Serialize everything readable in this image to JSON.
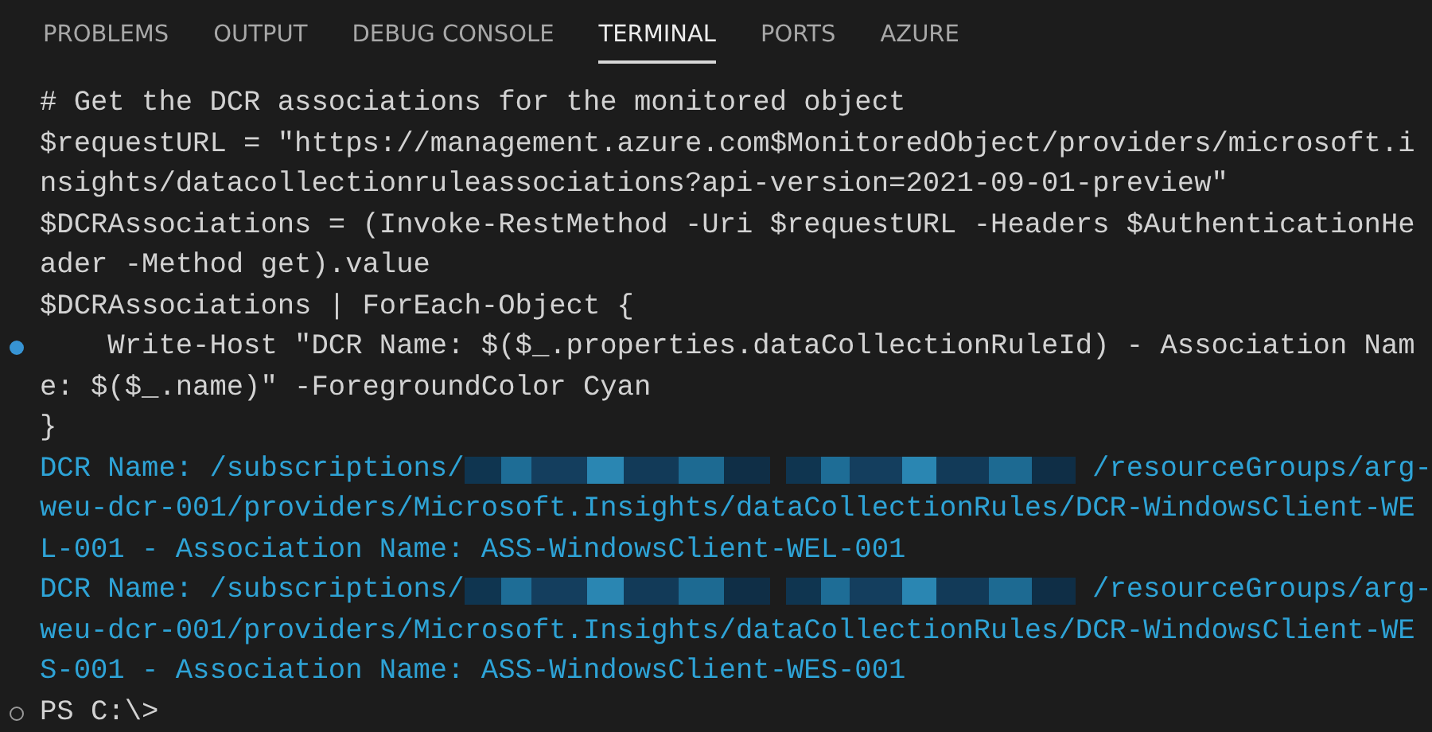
{
  "tabs": [
    {
      "label": "PROBLEMS",
      "selected": false
    },
    {
      "label": "OUTPUT",
      "selected": false
    },
    {
      "label": "DEBUG CONSOLE",
      "selected": false
    },
    {
      "label": "TERMINAL",
      "selected": true
    },
    {
      "label": "PORTS",
      "selected": false
    },
    {
      "label": "AZURE",
      "selected": false
    }
  ],
  "terminal": {
    "lines": [
      {
        "kind": "command",
        "segments": [
          {
            "kind": "text",
            "text": "# Get the DCR associations for the monitored object"
          }
        ]
      },
      {
        "kind": "command",
        "segments": [
          {
            "kind": "text",
            "text": "$requestURL = \"https://management.azure.com$MonitoredObject/providers/microsoft.i"
          }
        ]
      },
      {
        "kind": "command",
        "segments": [
          {
            "kind": "text",
            "text": "nsights/datacollectionruleassociations?api-version=2021-09-01-preview\""
          }
        ]
      },
      {
        "kind": "command",
        "segments": [
          {
            "kind": "text",
            "text": "$DCRAssociations = (Invoke-RestMethod -Uri $requestURL -Headers $AuthenticationHe"
          }
        ]
      },
      {
        "kind": "command",
        "segments": [
          {
            "kind": "text",
            "text": "ader -Method get).value"
          }
        ]
      },
      {
        "kind": "command",
        "segments": [
          {
            "kind": "text",
            "text": "$DCRAssociations | ForEach-Object {"
          }
        ]
      },
      {
        "kind": "command",
        "marker": {
          "kind": "dot"
        },
        "segments": [
          {
            "kind": "text",
            "text": "    Write-Host \"DCR Name: $($_.properties.dataCollectionRuleId) - Association Nam"
          }
        ]
      },
      {
        "kind": "command",
        "segments": [
          {
            "kind": "text",
            "text": "e: $($_.name)\" -ForegroundColor Cyan"
          }
        ]
      },
      {
        "kind": "command",
        "segments": [
          {
            "kind": "text",
            "text": "}"
          }
        ]
      },
      {
        "kind": "output",
        "segments": [
          {
            "kind": "text",
            "text": "DCR Name: /subscriptions/"
          },
          {
            "kind": "redaction"
          },
          {
            "kind": "redaction"
          },
          {
            "kind": "text",
            "text": "/resourceGroups/arg-"
          }
        ]
      },
      {
        "kind": "output",
        "segments": [
          {
            "kind": "text",
            "text": "weu-dcr-001/providers/Microsoft.Insights/dataCollectionRules/DCR-WindowsClient-WE"
          }
        ]
      },
      {
        "kind": "output",
        "segments": [
          {
            "kind": "text",
            "text": "L-001 - Association Name: ASS-WindowsClient-WEL-001"
          }
        ]
      },
      {
        "kind": "output",
        "segments": [
          {
            "kind": "text",
            "text": "DCR Name: /subscriptions/"
          },
          {
            "kind": "redaction"
          },
          {
            "kind": "redaction"
          },
          {
            "kind": "text",
            "text": "/resourceGroups/arg-"
          }
        ]
      },
      {
        "kind": "output",
        "segments": [
          {
            "kind": "text",
            "text": "weu-dcr-001/providers/Microsoft.Insights/dataCollectionRules/DCR-WindowsClient-WE"
          }
        ]
      },
      {
        "kind": "output",
        "segments": [
          {
            "kind": "text",
            "text": "S-001 - Association Name: ASS-WindowsClient-WES-001"
          }
        ]
      },
      {
        "kind": "command",
        "marker": {
          "kind": "circle"
        },
        "segments": [
          {
            "kind": "text",
            "text": "PS C:\\>"
          }
        ]
      }
    ]
  }
}
